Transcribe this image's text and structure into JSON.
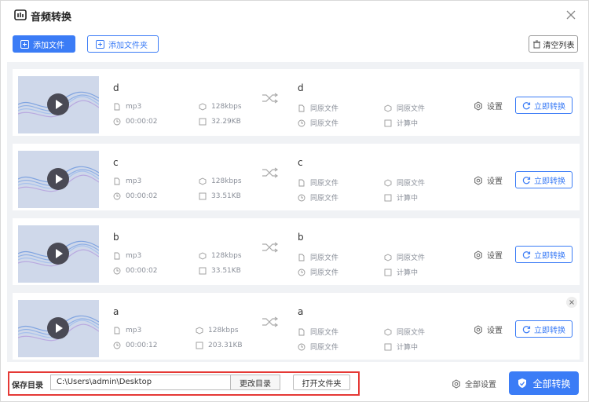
{
  "window": {
    "title": "音频转换"
  },
  "toolbar": {
    "add_file_label": "添加文件",
    "add_folder_label": "添加文件夹",
    "clear_list_label": "清空列表"
  },
  "items": [
    {
      "src_name": "d",
      "src_format": "mp3",
      "src_bitrate": "128kbps",
      "src_duration": "00:00:02",
      "src_size": "32.29KB",
      "dst_name": "d",
      "dst_format": "同原文件",
      "dst_bitrate": "同原文件",
      "dst_duration": "同原文件",
      "dst_size": "计算中",
      "settings_label": "设置",
      "convert_label": "立即转换"
    },
    {
      "src_name": "c",
      "src_format": "mp3",
      "src_bitrate": "128kbps",
      "src_duration": "00:00:02",
      "src_size": "33.51KB",
      "dst_name": "c",
      "dst_format": "同原文件",
      "dst_bitrate": "同原文件",
      "dst_duration": "同原文件",
      "dst_size": "计算中",
      "settings_label": "设置",
      "convert_label": "立即转换"
    },
    {
      "src_name": "b",
      "src_format": "mp3",
      "src_bitrate": "128kbps",
      "src_duration": "00:00:02",
      "src_size": "33.51KB",
      "dst_name": "b",
      "dst_format": "同原文件",
      "dst_bitrate": "同原文件",
      "dst_duration": "同原文件",
      "dst_size": "计算中",
      "settings_label": "设置",
      "convert_label": "立即转换"
    },
    {
      "src_name": "a",
      "src_format": "mp3",
      "src_bitrate": "128kbps",
      "src_duration": "00:00:12",
      "src_size": "203.31KB",
      "dst_name": "a",
      "dst_format": "同原文件",
      "dst_bitrate": "同原文件",
      "dst_duration": "同原文件",
      "dst_size": "计算中",
      "settings_label": "设置",
      "convert_label": "立即转换"
    }
  ],
  "footer": {
    "save_dir_label": "保存目录",
    "save_dir_value": "C:\\Users\\admin\\Desktop",
    "change_dir_label": "更改目录",
    "open_folder_label": "打开文件夹",
    "all_settings_label": "全部设置",
    "convert_all_label": "全部转换"
  },
  "colors": {
    "accent": "#3b7cf6",
    "highlight_border": "#e53935"
  }
}
